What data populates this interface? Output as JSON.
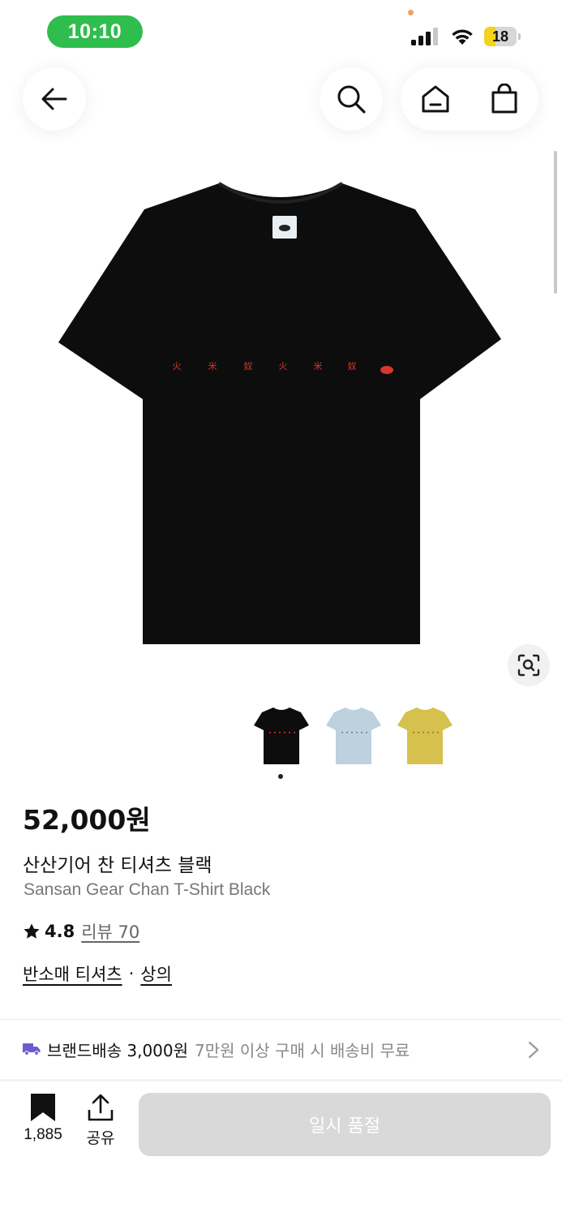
{
  "status_bar": {
    "time": "10:10",
    "battery": "18",
    "time_pill_color": "#2fbd4e"
  },
  "nav": {
    "back_icon": "arrow-left-icon",
    "search_icon": "search-icon",
    "home_icon": "home-icon",
    "cart_icon": "shopping-bag-icon"
  },
  "product": {
    "shirt_print": [
      "火",
      "米",
      "奴",
      "火",
      "米",
      "奴"
    ],
    "colors": [
      {
        "name": "black",
        "hex": "#0d0d0d",
        "selected": true
      },
      {
        "name": "light-blue",
        "hex": "#bdd1de",
        "selected": false
      },
      {
        "name": "yellow",
        "hex": "#d6c14e",
        "selected": false
      }
    ],
    "price": "52,000원",
    "name_ko": "산산기어 찬 티셔츠 블랙",
    "name_en": "Sansan Gear Chan T-Shirt Black",
    "rating": "4.8",
    "review_label": "리뷰 70",
    "categories": [
      "반소매 티셔츠",
      "상의"
    ],
    "category_separator": "·"
  },
  "shipping": {
    "main": "브랜드배송 3,000원",
    "sub": "7만원 이상 구매 시 배송비 무료",
    "icon": "truck-icon",
    "icon_color": "#6d5bd0"
  },
  "bottom_bar": {
    "bookmark_count": "1,885",
    "share_label": "공유",
    "cta_label": "일시 품절"
  }
}
